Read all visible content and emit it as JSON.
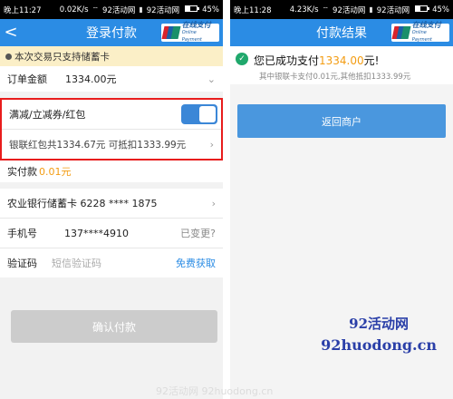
{
  "left_screen": {
    "status_bar": {
      "time": "晚上11:27",
      "speed": "0.02K/s",
      "carrier1": "92活动网",
      "carrier2": "92活动网",
      "battery": "45%",
      "battery_level": 0.45
    },
    "header": {
      "title": "登录付款",
      "logo_text": "在线支付",
      "logo_sub": "Online Payment",
      "logo_mark": "UnionPay 银联"
    },
    "notice": "本次交易只支持储蓄卡",
    "order": {
      "label": "订单金额",
      "value": "1334.00元"
    },
    "discount": {
      "label": "满减/立减券/红包",
      "toggle_on": true
    },
    "red_packet": "银联红包共1334.67元 可抵扣1333.99元",
    "actual": {
      "label": "实付款",
      "value": "0.01元"
    },
    "bank_card": "农业银行储蓄卡 6228 **** 1875",
    "phone": {
      "label": "手机号",
      "value": "137****4910",
      "change_link": "已变更?"
    },
    "code": {
      "label": "验证码",
      "placeholder": "短信验证码",
      "get_code": "免费获取"
    },
    "confirm_button": "确认付款"
  },
  "right_screen": {
    "status_bar": {
      "time": "晚上11:28",
      "speed": "4.23K/s",
      "carrier1": "92活动网",
      "carrier2": "92活动网",
      "battery": "45%",
      "battery_level": 0.45
    },
    "header": {
      "title": "付款结果",
      "logo_text": "在线支付",
      "logo_sub": "Online Payment",
      "logo_mark": "UnionPay 银联"
    },
    "result": {
      "prefix": "您已成功支付",
      "amount": "1334.00",
      "suffix": "元!",
      "detail": "其中银联卡支付0.01元,其他抵扣1333.99元"
    },
    "return_button": "返回商户"
  },
  "watermark": {
    "name": "92活动网",
    "url": "92huodong.cn",
    "bottom_text": "92活动网 92huodong.cn"
  },
  "colors": {
    "accent_blue": "#2b8ce4",
    "button_blue": "#4a97de",
    "amount_orange": "#f39c12",
    "highlight_red": "#e81c1c",
    "success_green": "#20a86c",
    "notice_bg": "#fbefc7"
  },
  "icons": [
    "back-arrow-icon",
    "chevron-right-icon",
    "check-circle-icon",
    "wifi-icon",
    "signal-icon",
    "battery-icon",
    "unionpay-logo"
  ]
}
